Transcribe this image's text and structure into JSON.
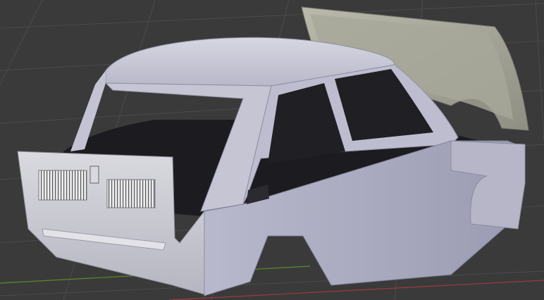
{
  "viewport": {
    "background_color": "#3a3a3a",
    "grid_color": "#4a4a4a",
    "axis_x_color": "#a0393f",
    "axis_y_color": "#5c8a2e"
  },
  "model": {
    "body_color": "#c9c9d6",
    "body_shadow_color": "#8e8ea3",
    "interior_color": "#1b1b1f",
    "hood_color": "#a9a99c"
  }
}
